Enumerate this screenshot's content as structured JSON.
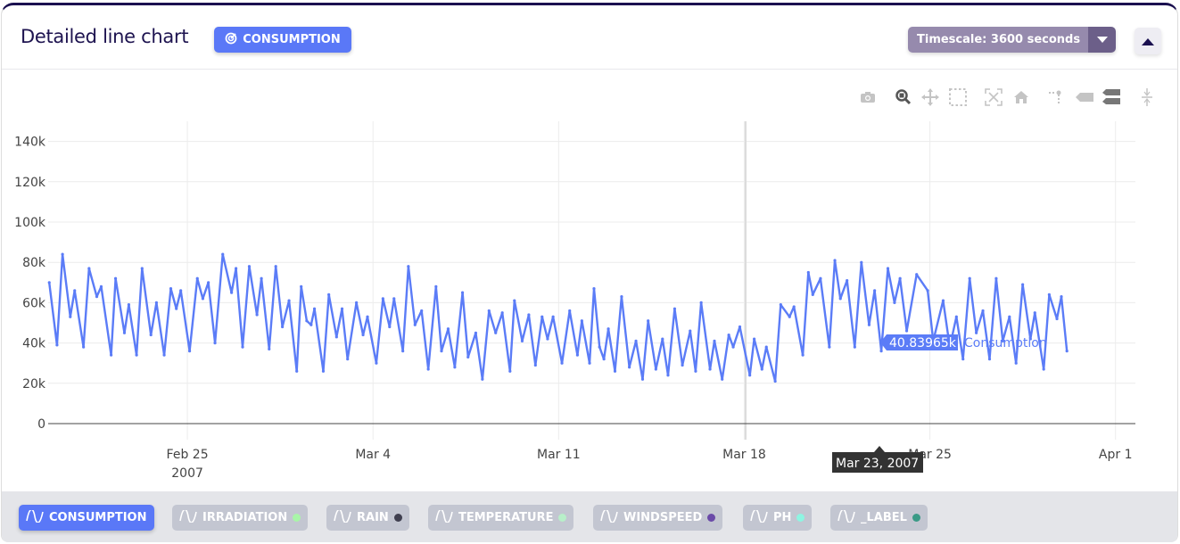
{
  "header": {
    "title": "Detailed line chart",
    "badge_label": "CONSUMPTION",
    "badge_icon": "target-icon",
    "timescale_label": "Timescale: 3600 seconds",
    "collapse_icon": "caret-up-icon"
  },
  "modebar": [
    "camera-icon",
    "zoom-icon",
    "pan-icon",
    "box-select-icon",
    "autoscale-icon",
    "home-icon",
    "spike-lines-icon",
    "hover-closest-icon",
    "hover-compare-icon",
    "compare-lines-icon"
  ],
  "colors": {
    "accent": "#5a78f7",
    "line": "#5b7cf7",
    "title": "#1e1450",
    "timescale": "#968aad"
  },
  "hover": {
    "value": "40.83965k",
    "series": "Consumption",
    "date": "Mar 23, 2007"
  },
  "legend": [
    {
      "label": "CONSUMPTION",
      "active": true,
      "color": "#5a78f7"
    },
    {
      "label": "IRRADIATION",
      "active": false,
      "color": "#a8f5a8"
    },
    {
      "label": "RAIN",
      "active": false,
      "color": "#3f3f4f"
    },
    {
      "label": "TEMPERATURE",
      "active": false,
      "color": "#b8efc9"
    },
    {
      "label": "WINDSPEED",
      "active": false,
      "color": "#6a4aa8"
    },
    {
      "label": "PH",
      "active": false,
      "color": "#8ef5e2"
    },
    {
      "label": "_LABEL",
      "active": false,
      "color": "#3a9a86"
    }
  ],
  "chart_data": {
    "type": "line",
    "title": "",
    "xlabel": "",
    "ylabel": "",
    "xlim": [
      "2007-02-19 18:00",
      "2007-04-01 18:00"
    ],
    "ylim": [
      0,
      150000
    ],
    "grid": true,
    "x_ticks": [
      {
        "date": "2007-02-25",
        "label": "Feb 25",
        "sub": "2007"
      },
      {
        "date": "2007-03-04",
        "label": "Mar 4",
        "sub": ""
      },
      {
        "date": "2007-03-11",
        "label": "Mar 11",
        "sub": ""
      },
      {
        "date": "2007-03-18",
        "label": "Mar 18",
        "sub": ""
      },
      {
        "date": "2007-03-25",
        "label": "Mar 25",
        "sub": ""
      },
      {
        "date": "2007-04-01",
        "label": "Apr 1",
        "sub": ""
      }
    ],
    "y_ticks": [
      {
        "value": 0,
        "label": "0"
      },
      {
        "value": 20000,
        "label": "20k"
      },
      {
        "value": 40000,
        "label": "40k"
      },
      {
        "value": 60000,
        "label": "60k"
      },
      {
        "value": 80000,
        "label": "80k"
      },
      {
        "value": 100000,
        "label": "100k"
      },
      {
        "value": 120000,
        "label": "120k"
      },
      {
        "value": 140000,
        "label": "140k"
      }
    ],
    "series": [
      {
        "name": "Consumption",
        "color": "#5b7cf7",
        "points": [
          [
            "2007-02-19 19:00",
            70000
          ],
          [
            "2007-02-20 02:00",
            39000
          ],
          [
            "2007-02-20 07:00",
            84000
          ],
          [
            "2007-02-20 14:00",
            53000
          ],
          [
            "2007-02-20 18:00",
            66000
          ],
          [
            "2007-02-21 02:00",
            38000
          ],
          [
            "2007-02-21 07:00",
            77000
          ],
          [
            "2007-02-21 14:00",
            63000
          ],
          [
            "2007-02-21 18:00",
            68000
          ],
          [
            "2007-02-22 03:00",
            34000
          ],
          [
            "2007-02-22 07:00",
            72000
          ],
          [
            "2007-02-22 15:00",
            45000
          ],
          [
            "2007-02-22 19:00",
            59000
          ],
          [
            "2007-02-23 02:00",
            34000
          ],
          [
            "2007-02-23 07:00",
            77000
          ],
          [
            "2007-02-23 15:00",
            44000
          ],
          [
            "2007-02-23 20:00",
            60000
          ],
          [
            "2007-02-24 03:00",
            34000
          ],
          [
            "2007-02-24 09:00",
            67000
          ],
          [
            "2007-02-24 14:00",
            57000
          ],
          [
            "2007-02-24 18:00",
            66000
          ],
          [
            "2007-02-25 02:00",
            36000
          ],
          [
            "2007-02-25 09:00",
            72000
          ],
          [
            "2007-02-25 14:00",
            62000
          ],
          [
            "2007-02-25 19:00",
            70000
          ],
          [
            "2007-02-26 01:00",
            40000
          ],
          [
            "2007-02-26 08:00",
            84000
          ],
          [
            "2007-02-26 16:00",
            65000
          ],
          [
            "2007-02-26 20:00",
            77000
          ],
          [
            "2007-02-27 02:00",
            38000
          ],
          [
            "2007-02-27 08:00",
            78000
          ],
          [
            "2007-02-27 15:00",
            54000
          ],
          [
            "2007-02-27 19:00",
            72000
          ],
          [
            "2007-02-28 02:00",
            37000
          ],
          [
            "2007-02-28 08:00",
            78000
          ],
          [
            "2007-02-28 14:00",
            48000
          ],
          [
            "2007-02-28 20:00",
            61000
          ],
          [
            "2007-03-01 03:00",
            26000
          ],
          [
            "2007-03-01 07:00",
            68000
          ],
          [
            "2007-03-01 12:00",
            51000
          ],
          [
            "2007-03-01 16:00",
            49000
          ],
          [
            "2007-03-01 19:00",
            57000
          ],
          [
            "2007-03-02 03:00",
            26000
          ],
          [
            "2007-03-02 08:00",
            64000
          ],
          [
            "2007-03-02 15:00",
            43000
          ],
          [
            "2007-03-02 20:00",
            57000
          ],
          [
            "2007-03-03 01:00",
            32000
          ],
          [
            "2007-03-03 09:00",
            60000
          ],
          [
            "2007-03-03 15:00",
            44000
          ],
          [
            "2007-03-03 19:00",
            53000
          ],
          [
            "2007-03-04 03:00",
            30000
          ],
          [
            "2007-03-04 09:00",
            62000
          ],
          [
            "2007-03-04 15:00",
            48000
          ],
          [
            "2007-03-04 19:00",
            62000
          ],
          [
            "2007-03-05 03:00",
            36000
          ],
          [
            "2007-03-05 08:00",
            78000
          ],
          [
            "2007-03-05 14:00",
            49000
          ],
          [
            "2007-03-05 20:00",
            56000
          ],
          [
            "2007-03-06 02:00",
            27000
          ],
          [
            "2007-03-06 09:00",
            68000
          ],
          [
            "2007-03-06 14:00",
            36000
          ],
          [
            "2007-03-06 20:00",
            47000
          ],
          [
            "2007-03-07 02:00",
            28000
          ],
          [
            "2007-03-07 09:00",
            65000
          ],
          [
            "2007-03-07 14:00",
            33000
          ],
          [
            "2007-03-07 21:00",
            45000
          ],
          [
            "2007-03-08 03:00",
            22000
          ],
          [
            "2007-03-08 09:00",
            56000
          ],
          [
            "2007-03-08 15:00",
            45000
          ],
          [
            "2007-03-08 21:00",
            55000
          ],
          [
            "2007-03-09 04:00",
            26000
          ],
          [
            "2007-03-09 08:00",
            61000
          ],
          [
            "2007-03-09 15:00",
            41000
          ],
          [
            "2007-03-09 21:00",
            54000
          ],
          [
            "2007-03-10 03:00",
            29000
          ],
          [
            "2007-03-10 09:00",
            53000
          ],
          [
            "2007-03-10 14:00",
            42000
          ],
          [
            "2007-03-10 19:00",
            53000
          ],
          [
            "2007-03-11 03:00",
            30000
          ],
          [
            "2007-03-11 10:00",
            56000
          ],
          [
            "2007-03-11 17:00",
            34000
          ],
          [
            "2007-03-11 21:00",
            51000
          ],
          [
            "2007-03-12 04:00",
            30000
          ],
          [
            "2007-03-12 08:00",
            67000
          ],
          [
            "2007-03-12 13:00",
            38000
          ],
          [
            "2007-03-12 17:00",
            32000
          ],
          [
            "2007-03-12 21:00",
            47000
          ],
          [
            "2007-03-13 03:00",
            26000
          ],
          [
            "2007-03-13 09:00",
            63000
          ],
          [
            "2007-03-13 16:00",
            28000
          ],
          [
            "2007-03-13 22:00",
            41000
          ],
          [
            "2007-03-14 04:00",
            22000
          ],
          [
            "2007-03-14 09:00",
            51000
          ],
          [
            "2007-03-14 16:00",
            27000
          ],
          [
            "2007-03-14 22:00",
            42000
          ],
          [
            "2007-03-15 03:00",
            24000
          ],
          [
            "2007-03-15 09:00",
            57000
          ],
          [
            "2007-03-15 16:00",
            29000
          ],
          [
            "2007-03-15 23:00",
            46000
          ],
          [
            "2007-03-16 04:00",
            26000
          ],
          [
            "2007-03-16 09:00",
            60000
          ],
          [
            "2007-03-16 17:00",
            27000
          ],
          [
            "2007-03-16 21:00",
            41000
          ],
          [
            "2007-03-17 04:00",
            22000
          ],
          [
            "2007-03-17 10:00",
            44000
          ],
          [
            "2007-03-17 14:00",
            38000
          ],
          [
            "2007-03-17 20:00",
            48000
          ],
          [
            "2007-03-18 05:00",
            24000
          ],
          [
            "2007-03-18 09:00",
            42000
          ],
          [
            "2007-03-18 16:00",
            27000
          ],
          [
            "2007-03-18 20:00",
            38000
          ],
          [
            "2007-03-19 04:00",
            21000
          ],
          [
            "2007-03-19 09:00",
            59000
          ],
          [
            "2007-03-19 17:00",
            53000
          ],
          [
            "2007-03-19 21:00",
            58000
          ],
          [
            "2007-03-20 05:00",
            34000
          ],
          [
            "2007-03-20 10:00",
            75000
          ],
          [
            "2007-03-20 14:00",
            64000
          ],
          [
            "2007-03-20 21:00",
            72000
          ],
          [
            "2007-03-21 05:00",
            38000
          ],
          [
            "2007-03-21 10:00",
            81000
          ],
          [
            "2007-03-21 15:00",
            62000
          ],
          [
            "2007-03-21 21:00",
            71000
          ],
          [
            "2007-03-22 04:00",
            38000
          ],
          [
            "2007-03-22 10:00",
            80000
          ],
          [
            "2007-03-22 17:00",
            49000
          ],
          [
            "2007-03-22 22:00",
            66000
          ],
          [
            "2007-03-23 04:00",
            36000
          ],
          [
            "2007-03-23 10:00",
            77000
          ],
          [
            "2007-03-23 16:00",
            60000
          ],
          [
            "2007-03-23 21:00",
            72000
          ],
          [
            "2007-03-24 03:00",
            46000
          ],
          [
            "2007-03-24 12:00",
            74000
          ],
          [
            "2007-03-24 22:00",
            66000
          ],
          [
            "2007-03-25 03:00",
            41000
          ],
          [
            "2007-03-25 12:00",
            61000
          ],
          [
            "2007-03-25 18:00",
            38000
          ],
          [
            "2007-03-26 00:00",
            53000
          ],
          [
            "2007-03-26 06:00",
            32000
          ],
          [
            "2007-03-26 12:00",
            72000
          ],
          [
            "2007-03-26 18:00",
            45000
          ],
          [
            "2007-03-27 00:00",
            56000
          ],
          [
            "2007-03-27 06:00",
            32000
          ],
          [
            "2007-03-27 12:00",
            72000
          ],
          [
            "2007-03-27 18:00",
            41000
          ],
          [
            "2007-03-28 00:00",
            53000
          ],
          [
            "2007-03-28 06:00",
            30000
          ],
          [
            "2007-03-28 12:00",
            69000
          ],
          [
            "2007-03-28 19:00",
            42000
          ],
          [
            "2007-03-28 23:00",
            55000
          ],
          [
            "2007-03-29 07:00",
            27000
          ],
          [
            "2007-03-29 12:00",
            64000
          ],
          [
            "2007-03-29 19:00",
            52000
          ],
          [
            "2007-03-29 23:00",
            63000
          ],
          [
            "2007-03-30 04:00",
            36000
          ]
        ]
      }
    ]
  }
}
